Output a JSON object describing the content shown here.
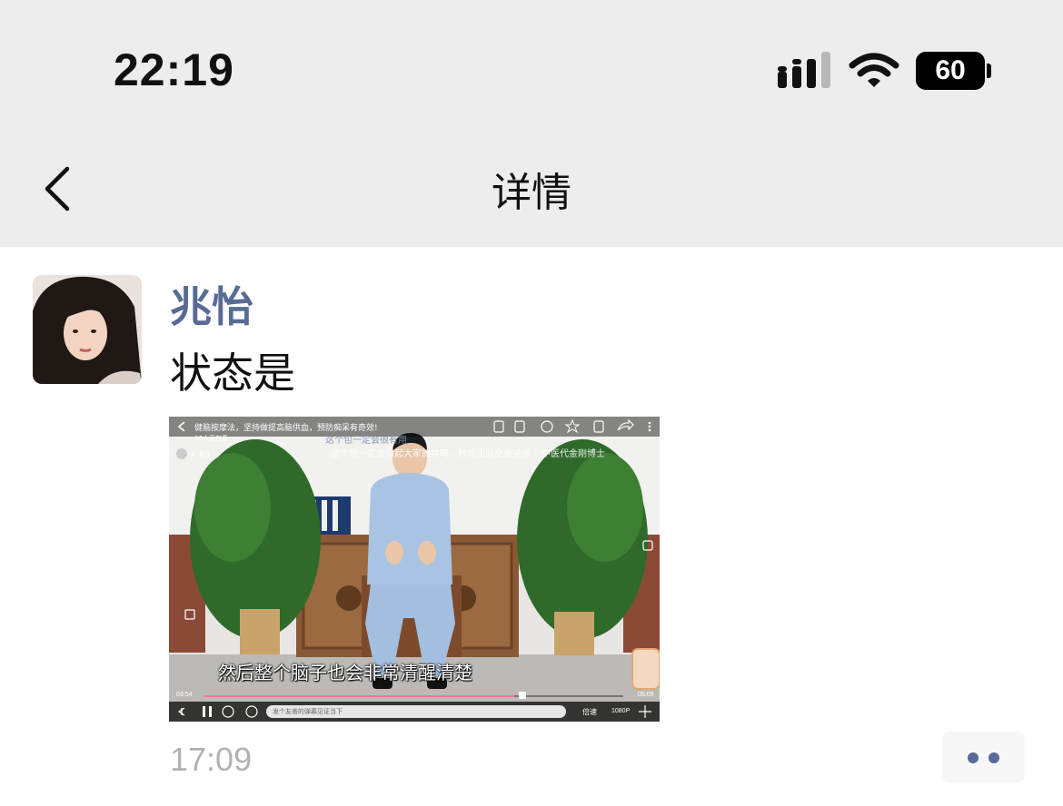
{
  "status_bar": {
    "time": "22:19",
    "battery_level": "60",
    "signal_icon": "cellular-signal-icon",
    "wifi_icon": "wifi-icon",
    "battery_icon": "battery-icon"
  },
  "nav": {
    "title": "详情",
    "back_icon": "chevron-left-icon"
  },
  "post": {
    "author": "兆怡",
    "text": "状态是",
    "time": "17:09",
    "more_icon": "two-dots-icon"
  },
  "video": {
    "header_title": "健脑按摩法，坚持做提高脑供血，预防痴呆有奇效!",
    "viewers": "36人正在看",
    "follow_label": "+ 关注",
    "overlay_line1": "这个包一定会很有用",
    "overlay_line2": "这个包一定会引起大家的共鸣，教师团队全面讲通",
    "overlay_author": "中医代金刚博士",
    "subtitle": "然后整个脑子也会非常清醒清楚",
    "time_current": "03:54",
    "time_total": "05:09",
    "danmaku_placeholder": "发个友善的弹幕见证当下",
    "speed_label": "倍速",
    "quality_label": "1080P",
    "progress": 0.74
  },
  "colors": {
    "link_name": "#576b95",
    "bar_bg": "#ededed",
    "timestamp": "#b2b2b2",
    "progress_played": "#fb7299"
  }
}
